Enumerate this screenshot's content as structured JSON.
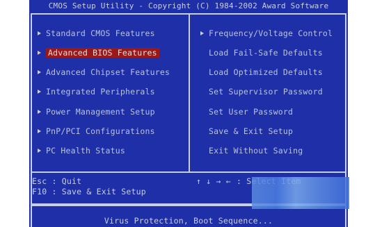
{
  "header": {
    "title": "CMOS Setup Utility - Copyright (C) 1984-2002 Award Software"
  },
  "left_menu": [
    {
      "label": "Standard CMOS Features"
    },
    {
      "label": "Advanced BIOS Features"
    },
    {
      "label": "Advanced Chipset Features"
    },
    {
      "label": "Integrated Peripherals"
    },
    {
      "label": "Power Management Setup"
    },
    {
      "label": "PnP/PCI Configurations"
    },
    {
      "label": "PC Health Status"
    }
  ],
  "right_menu": [
    {
      "label": "Frequency/Voltage Control"
    },
    {
      "label": "Load Fail-Safe Defaults"
    },
    {
      "label": "Load Optimized Defaults"
    },
    {
      "label": "Set Supervisor Password"
    },
    {
      "label": "Set User Password"
    },
    {
      "label": "Save & Exit Setup"
    },
    {
      "label": "Exit Without Saving"
    }
  ],
  "help": {
    "esc": "Esc : Quit",
    "f10": "F10 : Save & Exit Setup",
    "nav_keys": "↑ ↓ → ←",
    "select": ": Select Item"
  },
  "status": {
    "text": "Virus Protection, Boot Sequence..."
  },
  "colors": {
    "background": "#1f2fa8",
    "selection": "#9a1818",
    "frame": "#c8cfe8"
  }
}
